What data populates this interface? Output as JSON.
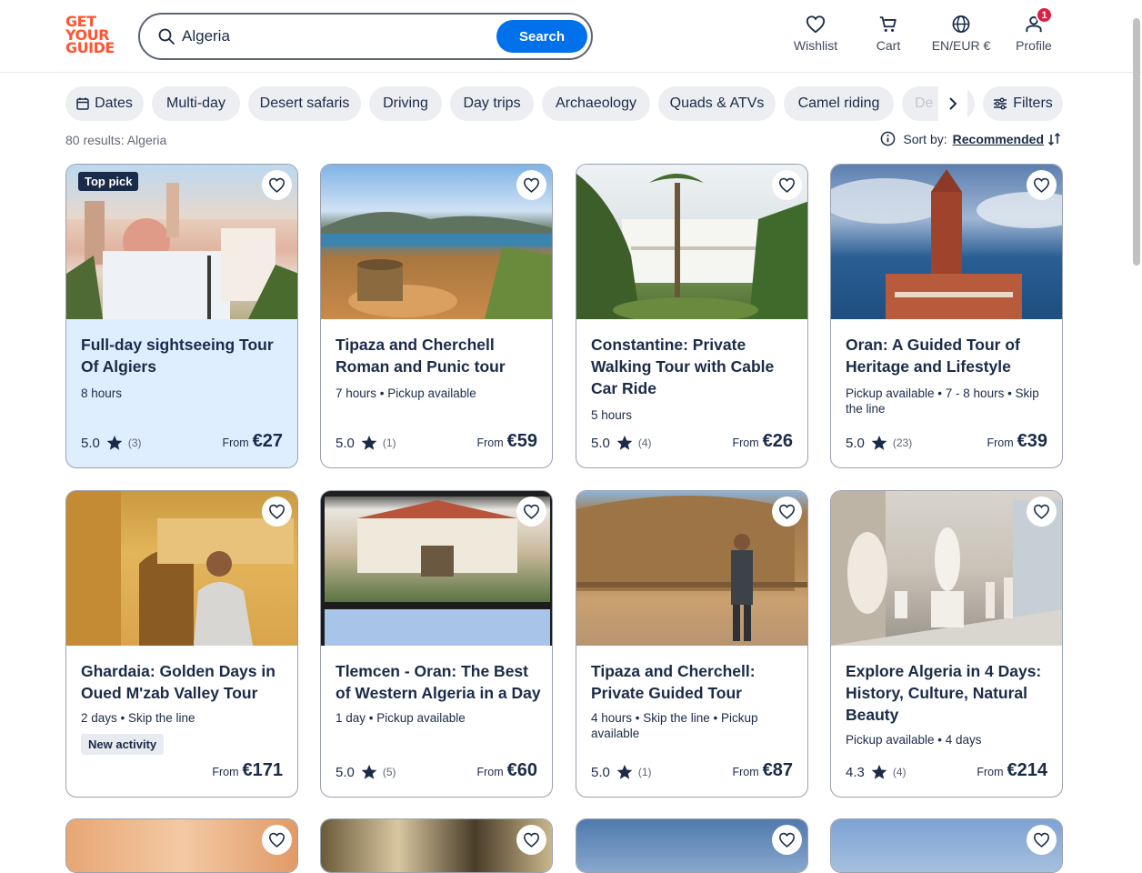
{
  "logo": [
    "GET",
    "YOUR",
    "GUIDE"
  ],
  "search": {
    "value": "Algeria",
    "button": "Search"
  },
  "nav": {
    "wishlist": "Wishlist",
    "cart": "Cart",
    "lang": "EN/EUR €",
    "profile": "Profile",
    "profile_badge": "1"
  },
  "chips": [
    "Dates",
    "Multi-day",
    "Desert safaris",
    "Driving",
    "Day trips",
    "Archaeology",
    "Quads & ATVs",
    "Camel riding",
    "De"
  ],
  "filters_label": "Filters",
  "results_text": "80 results: Algeria",
  "sort": {
    "label": "Sort by:",
    "value": "Recommended"
  },
  "colors": {
    "brand": "#ff5533",
    "accent": "#0071eb",
    "text": "#1a2b49",
    "highlight": "#dfeeff",
    "badge": "#dc1f42"
  },
  "cards": [
    {
      "title": "Full-day sightseeing Tour Of Algiers",
      "meta": "8 hours",
      "rating": "5.0",
      "count": "(3)",
      "from": "From",
      "price": "€27",
      "badge": "Top pick"
    },
    {
      "title": "Tipaza and Cherchell Roman and Punic tour",
      "meta": "7 hours • Pickup available",
      "rating": "5.0",
      "count": "(1)",
      "from": "From",
      "price": "€59"
    },
    {
      "title": "Constantine: Private Walking Tour with Cable Car Ride",
      "meta": "5 hours",
      "rating": "5.0",
      "count": "(4)",
      "from": "From",
      "price": "€26"
    },
    {
      "title": "Oran: A Guided Tour of Heritage and Lifestyle",
      "meta": "Pickup available • 7 - 8 hours • Skip the line",
      "rating": "5.0",
      "count": "(23)",
      "from": "From",
      "price": "€39"
    },
    {
      "title": "Ghardaia: Golden Days in Oued M'zab Valley Tour",
      "meta": "2 days • Skip the line",
      "from": "From",
      "price": "€171",
      "tag": "New activity"
    },
    {
      "title": "Tlemcen - Oran: The Best of Western Algeria in a Day",
      "meta": "1 day • Pickup available",
      "rating": "5.0",
      "count": "(5)",
      "from": "From",
      "price": "€60"
    },
    {
      "title": "Tipaza and Cherchell: Private Guided Tour",
      "meta": "4 hours • Skip the line • Pickup available",
      "rating": "5.0",
      "count": "(1)",
      "from": "From",
      "price": "€87"
    },
    {
      "title": "Explore Algeria in 4 Days: History, Culture, Natural Beauty",
      "meta": "Pickup available • 4 days",
      "rating": "4.3",
      "count": "(4)",
      "from": "From",
      "price": "€214"
    }
  ]
}
